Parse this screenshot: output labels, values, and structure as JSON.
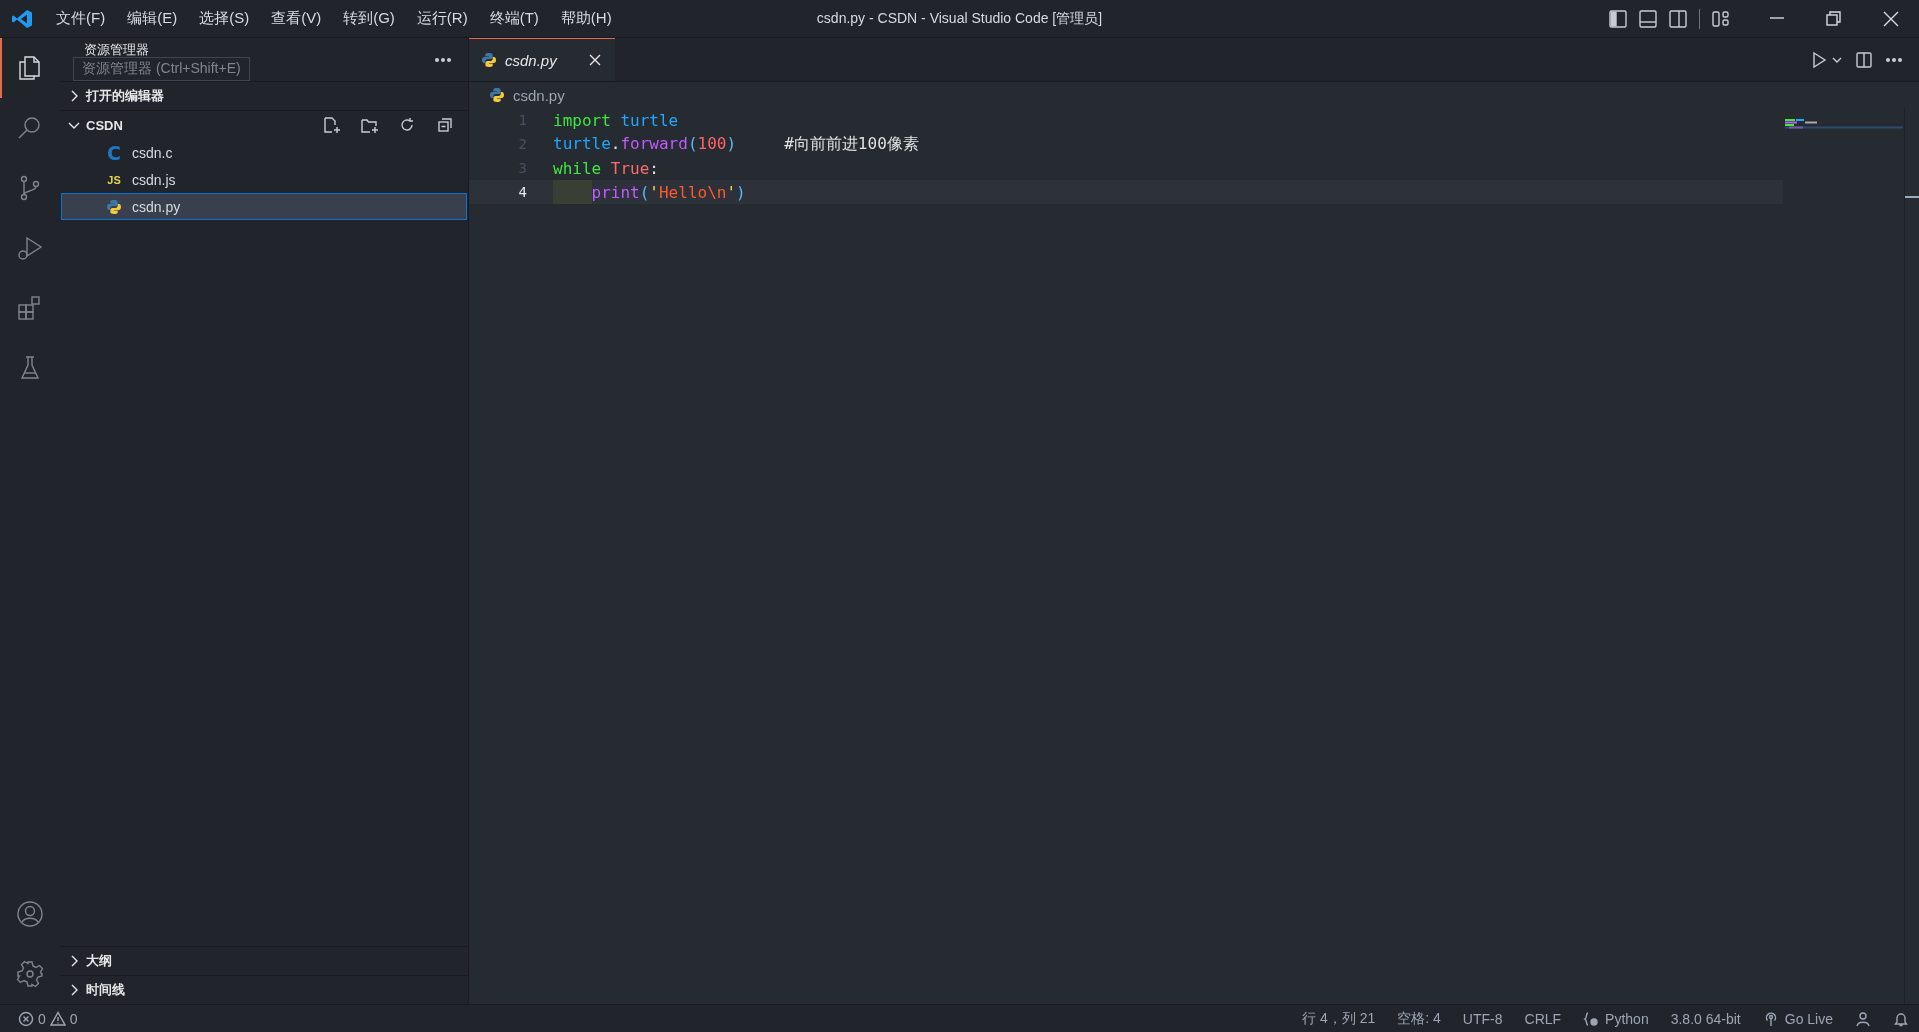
{
  "window": {
    "title": "csdn.py - CSDN - Visual Studio Code [管理员]"
  },
  "menu": [
    "文件(F)",
    "编辑(E)",
    "选择(S)",
    "查看(V)",
    "转到(G)",
    "运行(R)",
    "终端(T)",
    "帮助(H)"
  ],
  "activity_bar": {
    "items": [
      {
        "kind": "explorer",
        "selected": true
      },
      {
        "kind": "search",
        "selected": false
      },
      {
        "kind": "source-control",
        "selected": false
      },
      {
        "kind": "run-debug",
        "selected": false
      },
      {
        "kind": "extensions",
        "selected": false
      },
      {
        "kind": "testing",
        "selected": false
      }
    ]
  },
  "sidebar": {
    "title": "资源管理器",
    "tooltip": "资源管理器 (Ctrl+Shift+E)",
    "sections": [
      {
        "label": "打开的编辑器",
        "expanded": false
      },
      {
        "label": "CSDN",
        "expanded": true,
        "files": [
          {
            "name": "csdn.c",
            "kind": "c",
            "badge": "C",
            "selected": false
          },
          {
            "name": "csdn.js",
            "kind": "js",
            "badge": "JS",
            "selected": false
          },
          {
            "name": "csdn.py",
            "kind": "py",
            "selected": true
          }
        ]
      }
    ],
    "bottom_sections": [
      {
        "label": "大纲",
        "expanded": false
      },
      {
        "label": "时间线",
        "expanded": false
      }
    ]
  },
  "editor": {
    "tabs": [
      {
        "label": "csdn.py",
        "selected": true,
        "preview": true
      }
    ],
    "breadcrumb": "csdn.py",
    "lines": [
      {
        "number": "1",
        "current": false,
        "tokens": [
          {
            "text": "import",
            "kind": "keyword"
          },
          {
            "text": " turtle",
            "kind": "module"
          }
        ]
      },
      {
        "number": "2",
        "current": false,
        "tokens": [
          {
            "text": "turtle",
            "kind": "module"
          },
          {
            "text": ".",
            "kind": "plain"
          },
          {
            "text": "forward",
            "kind": "function"
          },
          {
            "text": "(",
            "kind": "paren"
          },
          {
            "text": "100",
            "kind": "number"
          },
          {
            "text": ")",
            "kind": "paren"
          },
          {
            "text": "     #向前前进100像素",
            "kind": "comment"
          }
        ]
      },
      {
        "number": "3",
        "current": false,
        "tokens": [
          {
            "text": "while",
            "kind": "keyword"
          },
          {
            "text": " True",
            "kind": "constant"
          },
          {
            "text": ":",
            "kind": "plain"
          }
        ]
      },
      {
        "number": "4",
        "current": true,
        "indent_guide": true,
        "tokens": [
          {
            "text": "print",
            "kind": "function"
          },
          {
            "text": "(",
            "kind": "paren"
          },
          {
            "text": "'",
            "kind": "quote"
          },
          {
            "text": "Hello\\n",
            "kind": "string"
          },
          {
            "text": "'",
            "kind": "quote"
          },
          {
            "text": ")",
            "kind": "paren"
          }
        ]
      }
    ]
  },
  "status_bar": {
    "errors": "0",
    "warnings": "0",
    "items": [
      {
        "text": "行 4，列 21",
        "kind": "text"
      },
      {
        "text": "空格: 4",
        "kind": "text"
      },
      {
        "text": "UTF-8",
        "kind": "text"
      },
      {
        "text": "CRLF",
        "kind": "text"
      },
      {
        "text": "Python",
        "kind": "language"
      },
      {
        "text": "3.8.0 64-bit",
        "kind": "text"
      },
      {
        "text": "Go Live",
        "kind": "live"
      }
    ]
  }
}
